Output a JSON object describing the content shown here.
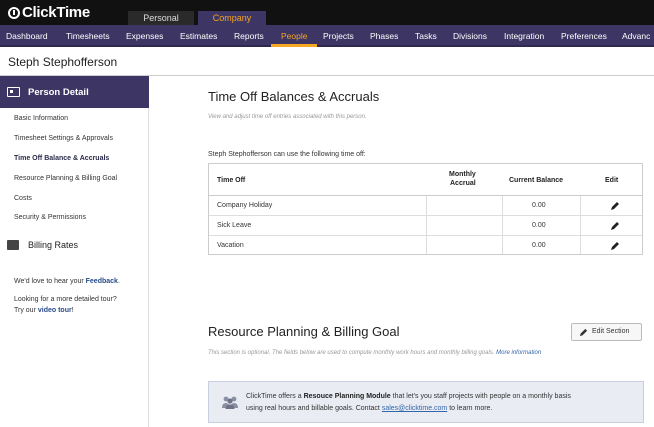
{
  "app": {
    "logo": "ClickTime"
  },
  "top_tabs": [
    {
      "label": "Personal"
    },
    {
      "label": "Company"
    }
  ],
  "nav": {
    "items": [
      "Dashboard",
      "Timesheets",
      "Expenses",
      "Estimates",
      "Reports",
      "People",
      "Projects",
      "Phases",
      "Tasks",
      "Divisions",
      "Integration",
      "Preferences",
      "Advanc"
    ],
    "active": "People"
  },
  "person": {
    "name": "Steph Stephofferson"
  },
  "sidebar": {
    "header": "Person Detail",
    "items": [
      "Basic Information",
      "Timesheet Settings & Approvals",
      "Time Off Balance & Accruals",
      "Resource Planning & Billing Goal",
      "Costs",
      "Security & Permissions"
    ],
    "active_index": 2,
    "billing_rates": "Billing Rates",
    "feedback": {
      "pre": "We'd love to hear your ",
      "link": "Feedback",
      "post": "."
    },
    "tour": {
      "line1": "Looking for a more detailed tour?",
      "pre": "Try our ",
      "link": "video tour",
      "post": "!"
    }
  },
  "balances": {
    "title": "Time Off Balances & Accruals",
    "subtitle": "View and adjust time off entries associated with this person.",
    "intro": "Steph Stephofferson can use the following time off:",
    "columns": {
      "time_off": "Time Off",
      "monthly_l1": "Monthly",
      "monthly_l2": "Accrual",
      "balance": "Current Balance",
      "edit": "Edit"
    },
    "rows": [
      {
        "name": "Company Holiday",
        "accrual": "",
        "balance": "0.00"
      },
      {
        "name": "Sick Leave",
        "accrual": "",
        "balance": "0.00"
      },
      {
        "name": "Vacation",
        "accrual": "",
        "balance": "0.00"
      }
    ]
  },
  "resource": {
    "title": "Resource Planning & Billing Goal",
    "edit_label": "Edit Section",
    "subtitle": "This section is optional. The fields below are used to compute monthly work hours and monthly billing goals.",
    "more_info": "More information",
    "module": {
      "line1_pre": "ClickTime offers a ",
      "line1_bold": "Resouce Planning Module",
      "line1_post": " that let's you staff projects with people on a monthly basis",
      "line2_pre": "using real hours and billable goals. Contact ",
      "line2_link": "sales@clicktime.com",
      "line2_post": " to learn more."
    }
  },
  "colors": {
    "nav_bg": "#3d3563",
    "accent": "#f5a623",
    "topbar": "#111111"
  }
}
